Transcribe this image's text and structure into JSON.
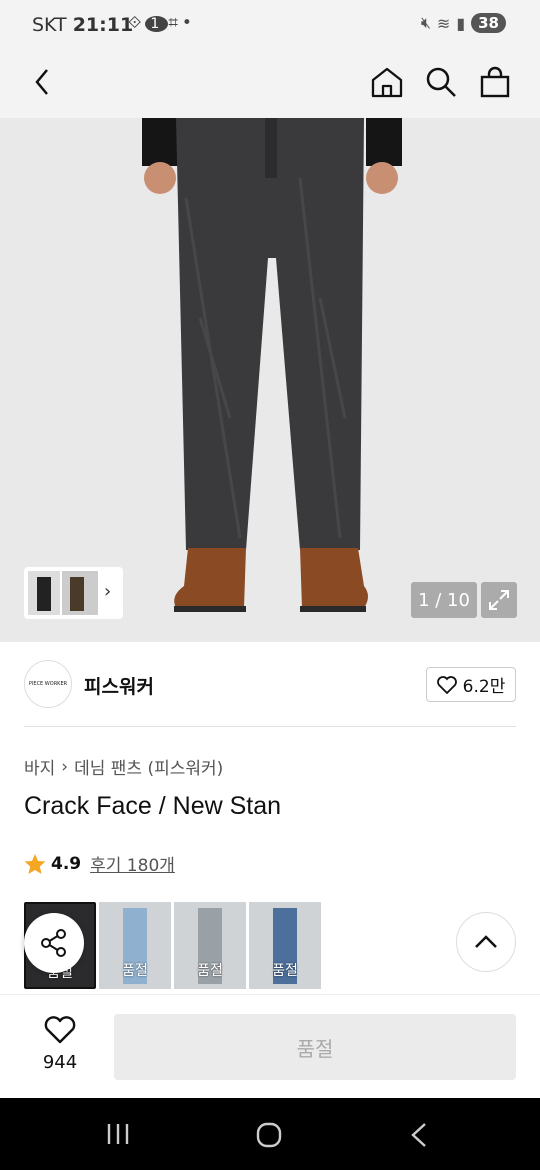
{
  "status_bar": {
    "carrier": "SKT",
    "time": "21:11",
    "notification_count": "1",
    "battery": "38"
  },
  "nav": {
    "back": "back",
    "home": "home",
    "search": "search",
    "cart": "cart"
  },
  "gallery": {
    "counter": "1 / 10"
  },
  "brand": {
    "logo_text": "PIECE WORKER",
    "name": "피스워커",
    "likes": "6.2만"
  },
  "breadcrumb": {
    "category": "바지",
    "subcategory": "데님 팬츠 (피스워커)"
  },
  "product": {
    "title": "Crack Face / New Stan",
    "rating": "4.9",
    "reviews": "후기 180개"
  },
  "options": [
    {
      "label": "품절",
      "color": "#2b2b2d"
    },
    {
      "label": "품절",
      "color": "#8fb0cf"
    },
    {
      "label": "품절",
      "color": "#9aa1a6"
    },
    {
      "label": "품절",
      "color": "#4c6f9b"
    }
  ],
  "bottom": {
    "wish_count": "944",
    "buy_label": "품절"
  },
  "colors": {
    "star": "#f5a623",
    "disabled_bg": "#ebebeb"
  }
}
